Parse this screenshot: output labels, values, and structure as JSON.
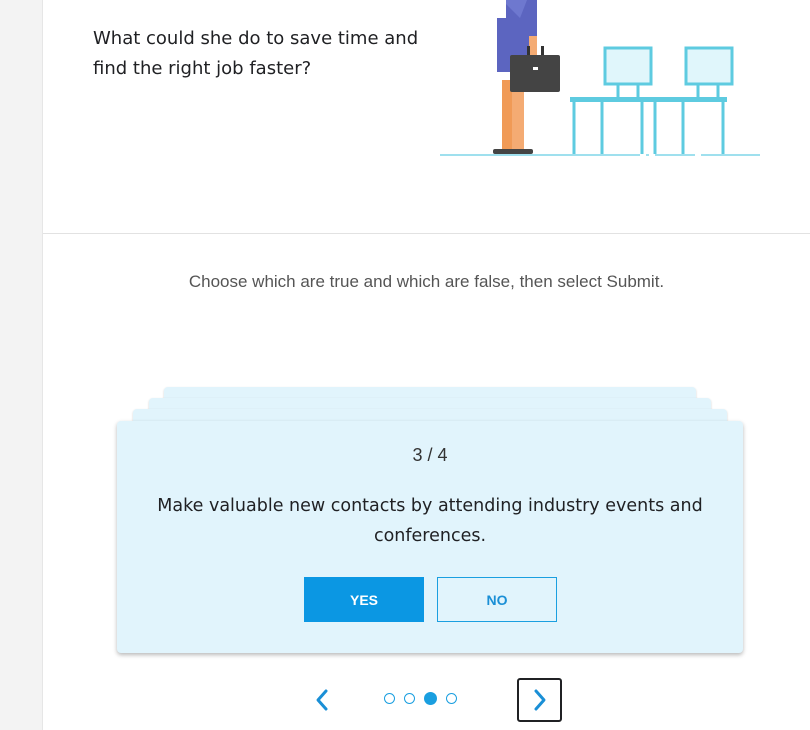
{
  "question": {
    "text": "What could she do to save time and find the right job faster?"
  },
  "instructions": "Choose which are true and which are false, then select Submit.",
  "card": {
    "counter": "3 / 4",
    "statement": "Make valuable new contacts by attending industry events and conferences.",
    "yes_label": "YES",
    "no_label": "NO"
  },
  "navigation": {
    "total_cards": 4,
    "current_card": 3,
    "prev_icon": "chevron-left-icon",
    "next_icon": "chevron-right-icon"
  },
  "colors": {
    "accent": "#0b97e3",
    "card_background": "#e1f4fc",
    "chair": "#5ecbe0"
  }
}
